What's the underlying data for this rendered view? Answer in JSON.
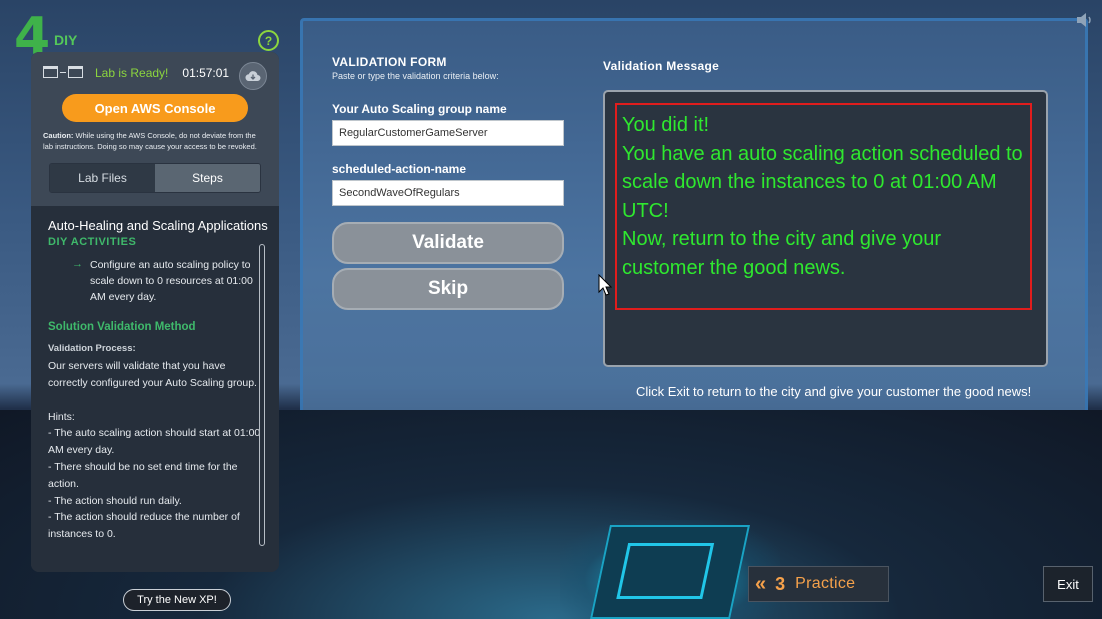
{
  "logo": {
    "mark": "4",
    "label": "DIY"
  },
  "help_glyph": "?",
  "status": {
    "ready_text": "Lab is Ready!",
    "timer": "01:57:01"
  },
  "aws_console_button": "Open AWS Console",
  "caution": {
    "label": "Caution:",
    "text": "While using the AWS Console, do not deviate from the lab instructions. Doing so may cause your access to be revoked."
  },
  "tabs": [
    {
      "label": "Lab Files",
      "active": false
    },
    {
      "label": "Steps",
      "active": true
    }
  ],
  "lab": {
    "title": "Auto-Healing and Scaling Applications",
    "section": "DIY ACTIVITIES",
    "activity_arrow": "→",
    "activity": "Configure an auto scaling policy to scale down to 0 resources at 01:00 AM every day.",
    "solution_heading": "Solution Validation Method",
    "process_label": "Validation Process:",
    "process_text": "Our servers will validate that you have correctly configured your Auto Scaling group.\n\nHints:\n- The auto scaling action should start at 01:00 AM every day.\n- There should be no set end time for the action.\n- The action should run daily.\n- The action should reduce the number of instances to 0."
  },
  "try_xp_button": "Try the New XP!",
  "form": {
    "title": "VALIDATION FORM",
    "subtitle": "Paste or type the validation criteria below:",
    "fields": [
      {
        "label": "Your Auto Scaling group name",
        "value": "RegularCustomerGameServer"
      },
      {
        "label": "scheduled-action-name",
        "value": "SecondWaveOfRegulars"
      }
    ],
    "validate_button": "Validate",
    "skip_button": "Skip"
  },
  "validation_message": {
    "label": "Validation Message",
    "lines": [
      "You did it!",
      "You have an auto scaling action scheduled to",
      "scale down the instances to 0 at 01:00 AM",
      "UTC!",
      "Now, return to the city and give your",
      "customer the good news."
    ]
  },
  "exit_hint": "Click Exit to return to the city and give your customer the good news!",
  "practice": {
    "chevrons": "«",
    "number": "3",
    "label": "Practice"
  },
  "exit_button": "Exit",
  "colors": {
    "accent_green": "#3fb96b",
    "message_green": "#2fe82f",
    "aws_orange": "#f89b1c",
    "highlight_red": "#e01d1d",
    "practice_orange": "#f5a14b"
  },
  "icons": [
    "window-icon",
    "cloud-icon",
    "help-icon",
    "speaker-icon",
    "arrow-right-icon",
    "cursor-icon",
    "chevrons-left-icon"
  ]
}
